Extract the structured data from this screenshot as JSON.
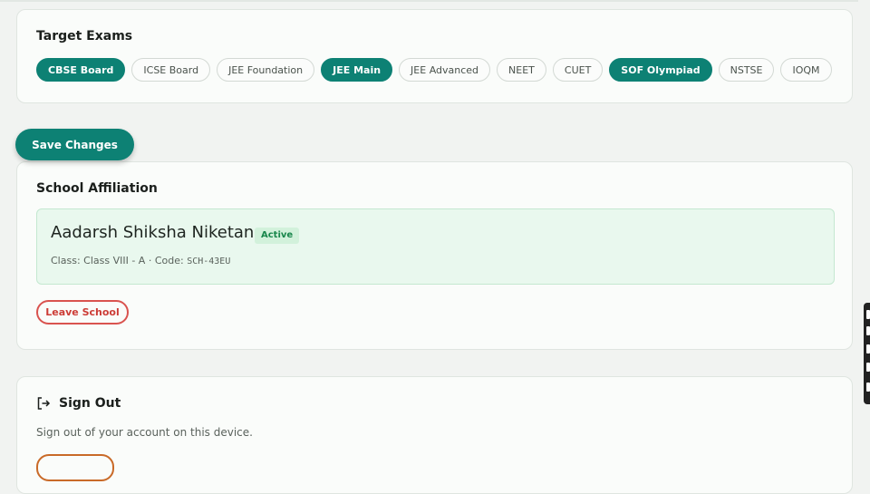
{
  "target_exams": {
    "title": "Target Exams",
    "chips": [
      {
        "label": "CBSE Board",
        "selected": true
      },
      {
        "label": "ICSE Board",
        "selected": false
      },
      {
        "label": "JEE Foundation",
        "selected": false
      },
      {
        "label": "JEE Main",
        "selected": true
      },
      {
        "label": "JEE Advanced",
        "selected": false
      },
      {
        "label": "NEET",
        "selected": false
      },
      {
        "label": "CUET",
        "selected": false
      },
      {
        "label": "SOF Olympiad",
        "selected": true
      },
      {
        "label": "NSTSE",
        "selected": false
      },
      {
        "label": "IOQM",
        "selected": false
      }
    ]
  },
  "save_button": "Save Changes",
  "school_affiliation": {
    "title": "School Affiliation",
    "school_name": "Aadarsh Shiksha Niketan",
    "status": "Active",
    "class_prefix": "Class: Class VIII - A · Code: ",
    "code": "SCH-43EU",
    "leave_button": "Leave School"
  },
  "sign_out": {
    "title": "Sign Out",
    "description": "Sign out of your account on this device."
  },
  "colors": {
    "accent": "#0d8174",
    "danger": "#d9534f",
    "success_bg": "#e9f8ee"
  }
}
